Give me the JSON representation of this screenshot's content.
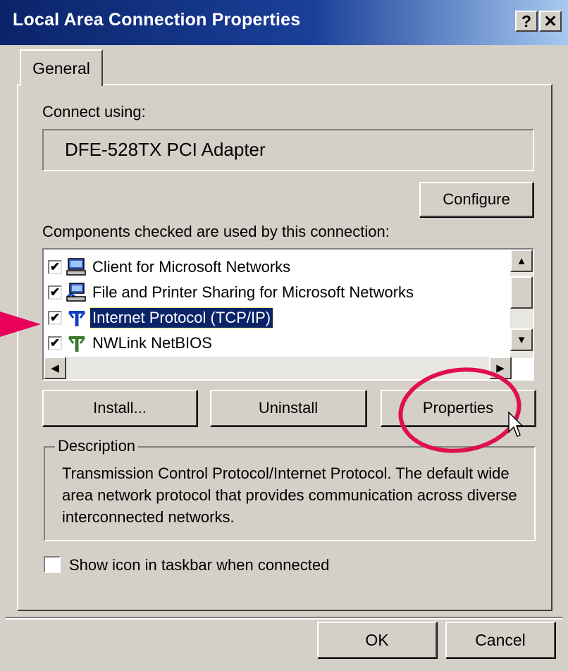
{
  "window": {
    "title": "Local Area Connection Properties",
    "help_button": "?",
    "close_button": "✕"
  },
  "tabs": [
    {
      "label": "General",
      "active": true
    }
  ],
  "connect_using": {
    "label": "Connect using:",
    "adapter": "DFE-528TX PCI Adapter",
    "configure_button": "Configure"
  },
  "components": {
    "label": "Components checked are used by this connection:",
    "items": [
      {
        "label": "Client for Microsoft Networks",
        "checked": true,
        "icon": "network-client-icon",
        "selected": false
      },
      {
        "label": "File and Printer Sharing for Microsoft Networks",
        "checked": true,
        "icon": "file-printer-sharing-icon",
        "selected": false
      },
      {
        "label": "Internet Protocol (TCP/IP)",
        "checked": true,
        "icon": "protocol-icon",
        "selected": true
      },
      {
        "label": "NWLink NetBIOS",
        "checked": true,
        "icon": "protocol-icon",
        "selected": false
      }
    ],
    "check_mark": "✔"
  },
  "actions": {
    "install": "Install...",
    "uninstall": "Uninstall",
    "properties": "Properties"
  },
  "description": {
    "legend": "Description",
    "text": "Transmission Control Protocol/Internet Protocol. The default wide area network protocol that provides communication across diverse interconnected networks."
  },
  "show_icon": {
    "label": "Show icon in taskbar when connected",
    "checked": false
  },
  "footer": {
    "ok": "OK",
    "cancel": "Cancel"
  },
  "scrollbar": {
    "up": "▲",
    "down": "▼",
    "left": "◀",
    "right": "▶"
  },
  "colors": {
    "titlebar_start": "#0a246a",
    "titlebar_end": "#a6caf0",
    "selection": "#0a246a",
    "annotation": "#e01050",
    "face": "#d4d0c8"
  }
}
